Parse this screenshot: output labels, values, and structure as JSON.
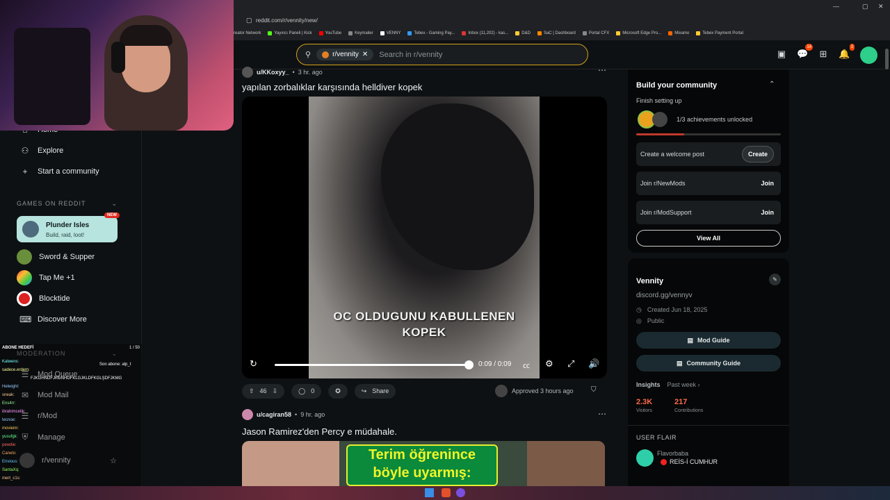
{
  "browser": {
    "url": "reddit.com/r/vennity/new/",
    "bookmarks": [
      "reator Network",
      "Yayıncı Paneli | Kick",
      "YouTube",
      "Keymailer",
      "VENNY",
      "Tebex - Gaming Pay...",
      "Inbox (11,202) - kas...",
      "D&D",
      "SaC | Dashboard",
      "Portal CFX",
      "Microsoft Edge Pro...",
      "Mixamo",
      "Tebex Payment Portal"
    ]
  },
  "header": {
    "search_chip": "r/vennity",
    "search_placeholder": "Search in r/vennity",
    "chat_badge": "14",
    "notif_badge": "3"
  },
  "sidebar": {
    "items": [
      {
        "label": "Home",
        "icon": "home-icon"
      },
      {
        "label": "Explore",
        "icon": "explore-icon"
      },
      {
        "label": "Start a community",
        "icon": "plus-icon"
      }
    ],
    "games_header": "GAMES ON REDDIT",
    "featured_game": {
      "title": "Plunder Isles",
      "subtitle": "Build, raid, loot!",
      "badge": "NEW"
    },
    "games": [
      "Sword & Supper",
      "Tap Me +1",
      "Blocktide",
      "Discover More"
    ],
    "moderation_header": "MODERATION",
    "mod_items": [
      "Mod Queue",
      "Mod Mail",
      "r/Mod",
      "Manage",
      "r/vennity"
    ]
  },
  "chat_overlay": {
    "goal": "ABONE HEDEFİ",
    "goal_count": "1 / 50",
    "last_sub": "Son abone: alp_t",
    "lines": [
      {
        "user": "Kalwens:",
        "msg": ""
      },
      {
        "user": "sadece.erdem:",
        "msg": ""
      },
      {
        "user": "",
        "msg": "FJKGHNDFJKGNHDFKLGJKLDFKGLŞDFJKMG"
      },
      {
        "user": "Helwight:",
        "msg": ""
      },
      {
        "user": "sneak:",
        "msg": ""
      },
      {
        "user": "Ens4rr:",
        "msg": ""
      },
      {
        "user": "ibrahimcelik:",
        "msg": ""
      },
      {
        "user": "tecnoe:",
        "msg": ""
      },
      {
        "user": "movieim:",
        "msg": ""
      },
      {
        "user": "yusufgk:",
        "msg": ""
      },
      {
        "user": "pewdie:",
        "msg": ""
      },
      {
        "user": "Canelo:",
        "msg": ""
      },
      {
        "user": "Envious:",
        "msg": ""
      },
      {
        "user": "SantaXq:",
        "msg": ""
      },
      {
        "user": "mert_c1s:",
        "msg": ""
      }
    ]
  },
  "posts": [
    {
      "user": "u/KKoxyy_",
      "time": "3 hr. ago",
      "title": "yapılan zorbalıklar karşısında helldiver kopek",
      "caption_line1": "OC OLDUGUNU KABULLENEN",
      "caption_line2": "KOPEK",
      "video_time": "0:09 / 0:09",
      "video_progress": 1.0,
      "votes": "46",
      "comments": "0",
      "share_label": "Share",
      "approved": "Approved 3 hours ago"
    },
    {
      "user": "u/cagiran58",
      "time": "9 hr. ago",
      "title": "Jason Ramirez'den Percy e müdahale.",
      "thumb_line1": "Terim öğrenince",
      "thumb_line2": "böyle uyarmış:"
    }
  ],
  "right_panel": {
    "build_title": "Build your community",
    "build_sub": "Finish setting up",
    "achievements": "1/3 achievements unlocked",
    "achievement_progress": 0.33,
    "tasks": [
      {
        "label": "Create a welcome post",
        "action": "Create"
      },
      {
        "label": "Join r/NewMods",
        "action": "Join"
      },
      {
        "label": "Join r/ModSupport",
        "action": "Join"
      }
    ],
    "view_all": "View All",
    "community_name": "Vennity",
    "community_link": "discord.gg/vennyv",
    "created": "Created Jun 18, 2025",
    "visibility": "Public",
    "mod_guide": "Mod Guide",
    "community_guide": "Community Guide",
    "insights_label": "Insights",
    "insights_period": "Past week ›",
    "visitors_value": "2.3K",
    "visitors_label": "Visitors",
    "contrib_value": "217",
    "contrib_label": "Contributions",
    "user_flair_header": "USER FLAIR",
    "flair_user": "Flavorbaba",
    "flair_text": "REİS-İ CUMHUR"
  },
  "colors": {
    "accent": "#ff4500",
    "bg": "#0e1113",
    "panel": "#060708"
  }
}
